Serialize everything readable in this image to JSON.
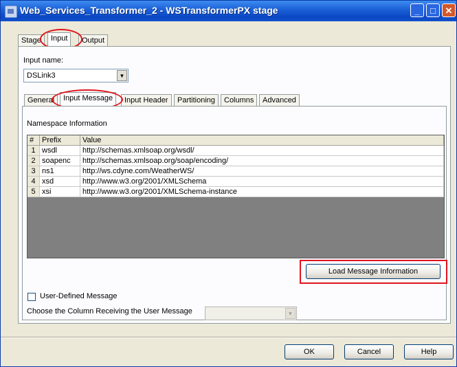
{
  "window": {
    "title": "Web_Services_Transformer_2 - WSTransformerPX stage"
  },
  "top_tabs": [
    "Stage",
    "Input",
    "Output"
  ],
  "input_name": {
    "label": "Input name:",
    "value": "DSLink3"
  },
  "sub_tabs": [
    "General",
    "Input Message",
    "Input Header",
    "Partitioning",
    "Columns",
    "Advanced"
  ],
  "namespace": {
    "heading": "Namespace Information",
    "columns": [
      "#",
      "Prefix",
      "Value"
    ],
    "rows": [
      {
        "num": "1",
        "prefix": "wsdl",
        "value": "http://schemas.xmlsoap.org/wsdl/"
      },
      {
        "num": "2",
        "prefix": "soapenc",
        "value": "http://schemas.xmlsoap.org/soap/encoding/"
      },
      {
        "num": "3",
        "prefix": "ns1",
        "value": "http://ws.cdyne.com/WeatherWS/"
      },
      {
        "num": "4",
        "prefix": "xsd",
        "value": "http://www.w3.org/2001/XMLSchema"
      },
      {
        "num": "5",
        "prefix": "xsi",
        "value": "http://www.w3.org/2001/XMLSchema-instance"
      }
    ]
  },
  "load_button": "Load Message Information",
  "user_defined": {
    "label": "User-Defined Message",
    "checked": false
  },
  "column_receiving": {
    "label": "Choose the Column Receiving the User Message",
    "value": ""
  },
  "footer": {
    "ok": "OK",
    "cancel": "Cancel",
    "help": "Help"
  },
  "colors": {
    "highlight": "#e0141e",
    "titlebar": "#1a5fd6",
    "dialog_bg": "#ece9d8",
    "grid_bg": "#808080"
  }
}
